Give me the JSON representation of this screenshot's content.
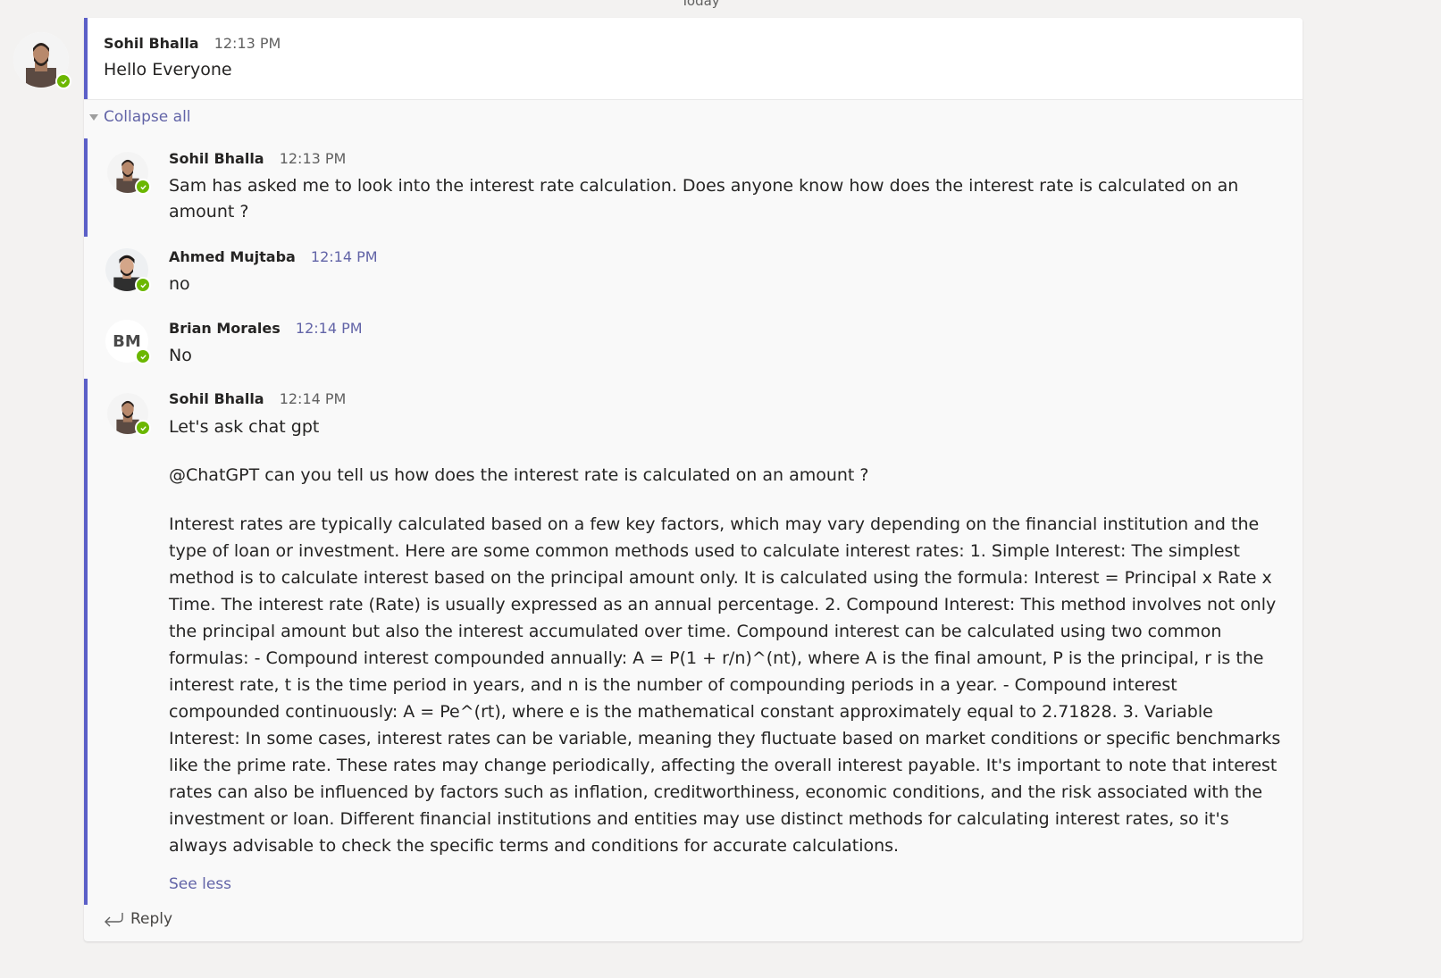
{
  "day_label": "Today",
  "colors": {
    "accent": "#6264a7",
    "thread_bar": "#5b5fc7",
    "presence": "#6bb700"
  },
  "root": {
    "author": "Sohil Bhalla",
    "time": "12:13 PM",
    "text": "Hello Everyone"
  },
  "collapse_label": "Collapse all",
  "replies": [
    {
      "author": "Sohil Bhalla",
      "time": "12:13 PM",
      "text": "Sam has asked me to look into the interest rate calculation. Does anyone know how does the interest rate is calculated on an amount ?"
    },
    {
      "author": "Ahmed Mujtaba",
      "time": "12:14 PM",
      "text": "no"
    },
    {
      "author": "Brian Morales",
      "initials": "BM",
      "time": "12:14 PM",
      "text": "No"
    },
    {
      "author": "Sohil Bhalla",
      "time": "12:14 PM",
      "line1": "Let's ask chat gpt",
      "line2": "@ChatGPT can you tell us how does the interest rate is calculated on an amount ?",
      "body": "Interest rates are typically calculated based on a few key factors, which may vary depending on the financial institution and the type of loan or investment. Here are some common methods used to calculate interest rates: 1. Simple Interest: The simplest method is to calculate interest based on the principal amount only. It is calculated using the formula: Interest = Principal x Rate x Time. The interest rate (Rate) is usually expressed as an annual percentage. 2. Compound Interest: This method involves not only the principal amount but also the interest accumulated over time. Compound interest can be calculated using two common formulas: - Compound interest compounded annually: A = P(1 + r/n)^(nt), where A is the final amount, P is the principal, r is the interest rate, t is the time period in years, and n is the number of compounding periods in a year. - Compound interest compounded continuously: A = Pe^(rt), where e is the mathematical constant approximately equal to 2.71828. 3. Variable Interest: In some cases, interest rates can be variable, meaning they fluctuate based on market conditions or specific benchmarks like the prime rate. These rates may change periodically, affecting the overall interest payable. It's important to note that interest rates can also be influenced by factors such as inflation, creditworthiness, economic conditions, and the risk associated with the investment or loan. Different financial institutions and entities may use distinct methods for calculating interest rates, so it's always advisable to check the specific terms and conditions for accurate calculations.",
      "see_less": "See less"
    }
  ],
  "reply_label": "Reply"
}
